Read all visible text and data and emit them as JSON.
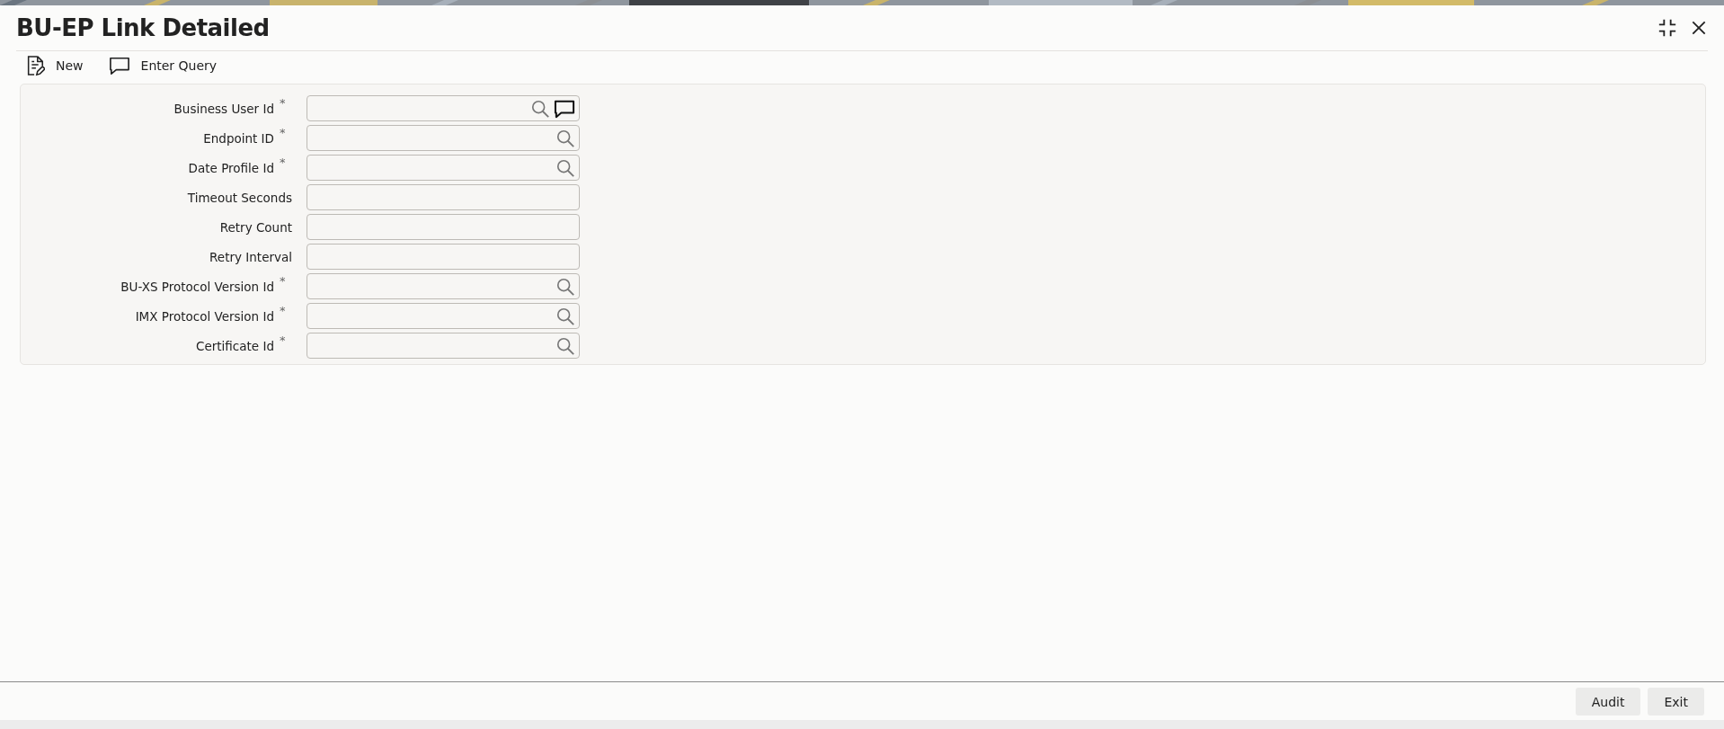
{
  "window": {
    "title": "BU-EP Link Detailed"
  },
  "toolbar": [
    {
      "label": "New",
      "kind": "new"
    },
    {
      "label": "Enter Query",
      "kind": "query"
    }
  ],
  "form": {
    "fields": [
      {
        "label": "Business User Id",
        "required": true,
        "kind": "lookup_chat"
      },
      {
        "label": "Endpoint ID",
        "required": true,
        "kind": "lookup"
      },
      {
        "label": "Date Profile Id",
        "required": true,
        "kind": "lookup"
      },
      {
        "label": "Timeout Seconds",
        "required": false,
        "kind": "plain"
      },
      {
        "label": "Retry Count",
        "required": false,
        "kind": "plain"
      },
      {
        "label": "Retry Interval",
        "required": false,
        "kind": "plain"
      },
      {
        "label": "BU-XS Protocol Version Id",
        "required": true,
        "kind": "lookup"
      },
      {
        "label": "IMX Protocol Version Id",
        "required": true,
        "kind": "lookup"
      },
      {
        "label": "Certificate Id",
        "required": true,
        "kind": "lookup"
      }
    ]
  },
  "required_mark": "*",
  "footer": {
    "buttons": [
      "Audit",
      "Exit"
    ]
  }
}
